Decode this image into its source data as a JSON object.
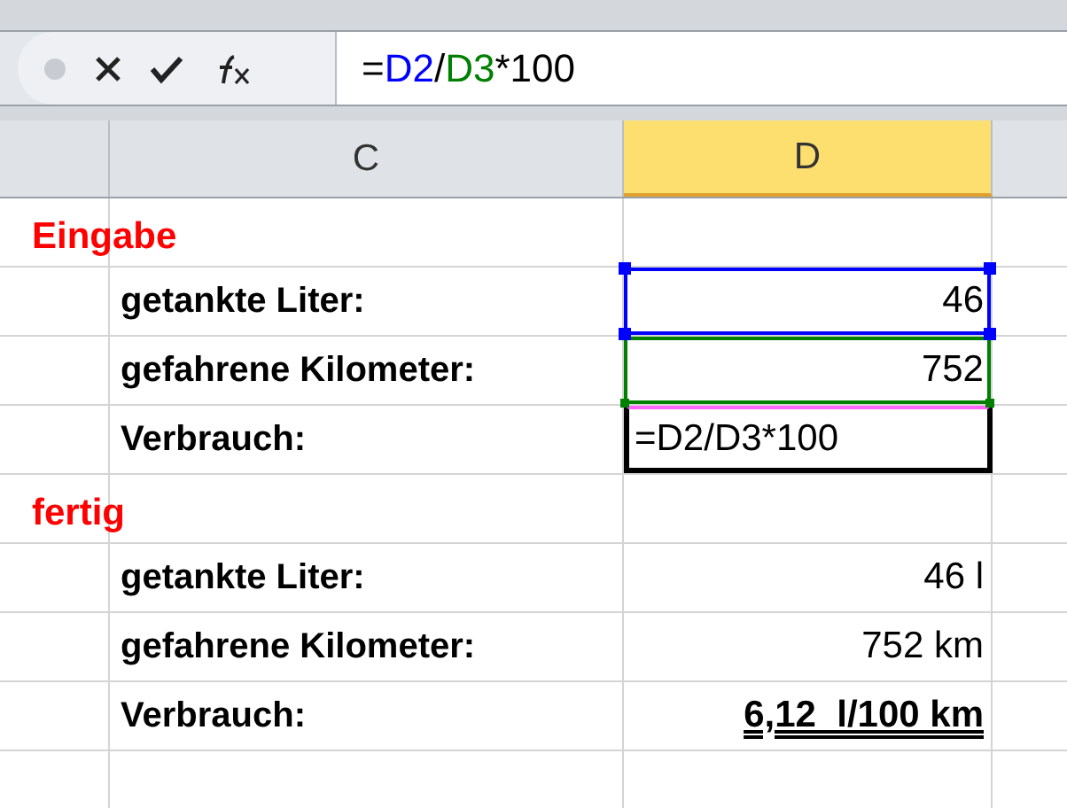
{
  "formula_bar": {
    "tokens": [
      {
        "text": "=",
        "color": "#000000"
      },
      {
        "text": "D2",
        "color": "#0000ff"
      },
      {
        "text": "/",
        "color": "#000000"
      },
      {
        "text": "D3",
        "color": "#008000"
      },
      {
        "text": "*100",
        "color": "#000000"
      }
    ]
  },
  "columns": [
    {
      "label": "C",
      "selected": false
    },
    {
      "label": "D",
      "selected": true
    }
  ],
  "rows": [
    {
      "kind": "section",
      "b": "Eingabe"
    },
    {
      "kind": "item",
      "c": "getankte Liter:",
      "d": "46",
      "color": "#0000ff"
    },
    {
      "kind": "item",
      "c": "gefahrene Kilometer:",
      "d": "752",
      "color": "#008000"
    },
    {
      "kind": "edit",
      "c": "Verbrauch:",
      "d": "=D2/D3*100"
    },
    {
      "kind": "section",
      "b": "fertig"
    },
    {
      "kind": "item",
      "c": "getankte Liter:",
      "d": "46 l"
    },
    {
      "kind": "item",
      "c": "gefahrene Kilometer:",
      "d": "752 km"
    },
    {
      "kind": "total",
      "c": "Verbrauch:",
      "d": "6,12  l/100 km"
    },
    {
      "kind": "empty"
    }
  ]
}
